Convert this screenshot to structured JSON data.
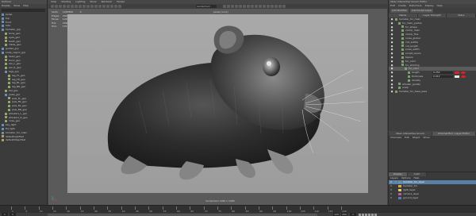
{
  "outliner": {
    "title": "Outliner",
    "menu": [
      "Display",
      "Show",
      "Help"
    ],
    "items": [
      {
        "label": "persp",
        "type": "camera",
        "indent": 0
      },
      {
        "label": "top",
        "type": "camera",
        "indent": 0
      },
      {
        "label": "front",
        "type": "camera",
        "indent": 0
      },
      {
        "label": "side",
        "type": "camera",
        "indent": 0
      },
      {
        "label": "hamster_grp",
        "type": "group",
        "indent": 0
      },
      {
        "label": "body_geo",
        "type": "mesh",
        "indent": 1
      },
      {
        "label": "eyes_geo",
        "type": "mesh",
        "indent": 1
      },
      {
        "label": "teeth_geo",
        "type": "mesh",
        "indent": 1
      },
      {
        "label": "claws_geo",
        "type": "mesh",
        "indent": 1
      },
      {
        "label": "guides_grp",
        "type": "group",
        "indent": 0
      },
      {
        "label": "scalp_region_grp",
        "type": "group",
        "indent": 0
      },
      {
        "label": "head_geo",
        "type": "mesh",
        "indent": 1
      },
      {
        "label": "torso_geo",
        "type": "mesh",
        "indent": 1
      },
      {
        "label": "ear_L_geo",
        "type": "mesh",
        "indent": 1
      },
      {
        "label": "ear_R_geo",
        "type": "mesh",
        "indent": 1
      },
      {
        "label": "legs_grp",
        "type": "group",
        "indent": 1
      },
      {
        "label": "leg_FL_geo",
        "type": "mesh",
        "indent": 2
      },
      {
        "label": "leg_FR_geo",
        "type": "mesh",
        "indent": 2
      },
      {
        "label": "leg_BL_geo",
        "type": "mesh",
        "indent": 2
      },
      {
        "label": "leg_BR_geo",
        "type": "mesh",
        "indent": 2
      },
      {
        "label": "tail_geo",
        "type": "mesh",
        "indent": 1
      },
      {
        "label": "paws_grp",
        "type": "group",
        "indent": 1
      },
      {
        "label": "paw_FL_geo",
        "type": "mesh",
        "indent": 2
      },
      {
        "label": "paw_FR_geo",
        "type": "mesh",
        "indent": 2
      },
      {
        "label": "paw_BL_geo",
        "type": "mesh",
        "indent": 2
      },
      {
        "label": "paw_BR_geo",
        "type": "mesh",
        "indent": 2
      },
      {
        "label": "whiskers_L_geo",
        "type": "mesh",
        "indent": 1
      },
      {
        "label": "whiskers_R_geo",
        "type": "mesh",
        "indent": 1
      },
      {
        "label": "nose_geo",
        "type": "mesh",
        "indent": 1
      },
      {
        "label": "key_light",
        "type": "group",
        "indent": 0
      },
      {
        "label": "fill_light",
        "type": "group",
        "indent": 0
      },
      {
        "label": "hamster_fur_main",
        "type": "group",
        "indent": 0
      },
      {
        "label": "defaultLightSet",
        "type": "set",
        "indent": 0
      },
      {
        "label": "defaultObjectSet",
        "type": "set",
        "indent": 0
      }
    ]
  },
  "viewport": {
    "menu": [
      "View",
      "Shading",
      "Lighting",
      "Show",
      "Renderer",
      "Panels"
    ],
    "camera_field": "renderCam",
    "camera_label": "persp (Lock)",
    "hud": [
      {
        "k": "Verts:",
        "a": "124582",
        "b": "0",
        "c": "0"
      },
      {
        "k": "Edges:",
        "a": "249104",
        "b": "0",
        "c": "0"
      },
      {
        "k": "Faces:",
        "a": "124540",
        "b": "0",
        "c": "0"
      },
      {
        "k": "Tris:",
        "a": "249080",
        "b": "0",
        "c": "0"
      },
      {
        "k": "UVs:",
        "a": "131206",
        "b": "0",
        "c": "0"
      }
    ],
    "resolution_label": "renderCam  1920 x 1080"
  },
  "timeline": {
    "ticks": [
      "1",
      "5",
      "10",
      "15",
      "20",
      "25",
      "30",
      "35",
      "40",
      "45",
      "50",
      "55",
      "60",
      "65",
      "70",
      "75",
      "80",
      "85",
      "90",
      "95",
      "100",
      "105",
      "110",
      "115",
      "120"
    ],
    "start": "1",
    "end": "120",
    "range_start": "1",
    "range_end": "200",
    "current": "1"
  },
  "xgen": {
    "title": "XGen Interactive Groom Editor",
    "menu": [
      "Edit",
      "Create",
      "Deformers",
      "Display",
      "Help"
    ],
    "buttons": [
      "Add Modifier",
      "Add Sculpt Layer"
    ],
    "tabs": [
      "Name",
      "Layer Strength",
      "Value"
    ],
    "rows": [
      {
        "label": "hamster_fur_main",
        "indent": 0,
        "val": "",
        "sel": false
      },
      {
        "label": "fur_main_guides",
        "indent": 1,
        "val": "",
        "sel": false
      },
      {
        "label": "fur_shape",
        "indent": 2,
        "val": "",
        "sel": false
      },
      {
        "label": "clump_main",
        "indent": 2,
        "val": "",
        "sel": false
      },
      {
        "label": "clump_fine",
        "indent": 2,
        "val": "",
        "sel": false
      },
      {
        "label": "noise_global",
        "indent": 2,
        "val": "",
        "sel": false
      },
      {
        "label": "coil_subtle",
        "indent": 2,
        "val": "",
        "sel": false
      },
      {
        "label": "cut_length",
        "indent": 2,
        "val": "",
        "sel": false
      },
      {
        "label": "scale_width",
        "indent": 2,
        "val": "",
        "sel": false
      },
      {
        "label": "sculpt_layers",
        "indent": 2,
        "val": "",
        "sel": false
      },
      {
        "label": "tapers",
        "indent": 2,
        "val": "",
        "sel": false
      },
      {
        "label": "fur_color",
        "indent": 2,
        "val": "",
        "sel": false
      },
      {
        "label": "fur_shading",
        "indent": 2,
        "val": "",
        "sel": false
      },
      {
        "label": "fur_color",
        "indent": 3,
        "val": "",
        "sel": true
      },
      {
        "label": "length",
        "indent": 4,
        "val": "0.250",
        "sel": false
      },
      {
        "label": "thickness",
        "indent": 4,
        "val": "0.012",
        "sel": false
      },
      {
        "label": "density",
        "indent": 4,
        "val": "",
        "sel": false
      },
      {
        "label": "whisker_guides",
        "indent": 1,
        "val": "",
        "sel": false
      },
      {
        "label": "scalp",
        "indent": 1,
        "val": "",
        "sel": false
      },
      {
        "label": "hamster_fur_base_pass",
        "indent": 0,
        "val": "",
        "sel": false
      }
    ]
  },
  "channel_box": {
    "tabs": [
      "XGen Interactive Groom",
      "Channel Box / Layer Editor"
    ],
    "menu": [
      "Channels",
      "Edit",
      "Object",
      "Show"
    ]
  },
  "layers": {
    "tabs": [
      "Display",
      "Anim"
    ],
    "menu": [
      "Layers",
      "Options",
      "Help"
    ],
    "rows": [
      {
        "v": "V",
        "p": "P",
        "label": "hamster_fur_layer",
        "color": "#6a8fb5",
        "sel": true
      },
      {
        "v": "V",
        "p": "",
        "label": "hamster_fur",
        "color": "#d9a64a",
        "sel": false
      },
      {
        "v": "V",
        "p": "",
        "label": "light_layer",
        "color": "#d9d24a",
        "sel": false
      },
      {
        "v": "V",
        "p": "",
        "label": "camera_layer",
        "color": "#b55ab5",
        "sel": false
      },
      {
        "v": "V",
        "p": "",
        "label": "ground_layer",
        "color": "#5a7ab5",
        "sel": false
      }
    ]
  }
}
